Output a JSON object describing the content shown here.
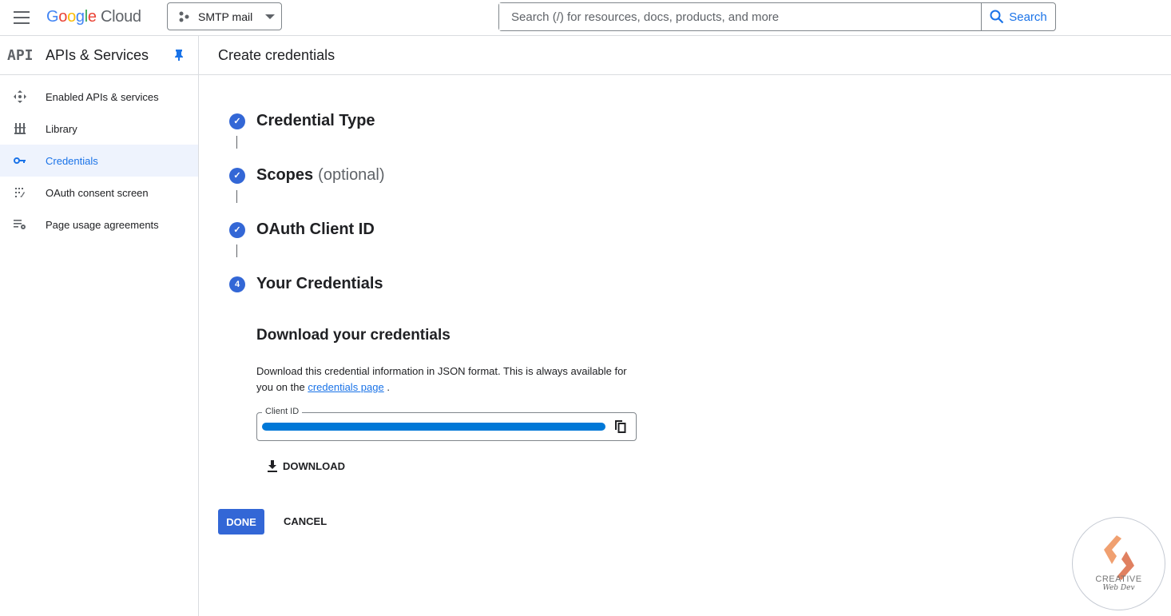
{
  "header": {
    "logo": {
      "google": "Google",
      "cloud": "Cloud"
    },
    "project": "SMTP mail",
    "search_placeholder": "Search (/) for resources, docs, products, and more",
    "search_button": "Search"
  },
  "sidebar": {
    "badge": "API",
    "title": "APIs & Services",
    "items": [
      {
        "label": "Enabled APIs & services",
        "icon": "enabled-apis-icon"
      },
      {
        "label": "Library",
        "icon": "library-icon"
      },
      {
        "label": "Credentials",
        "icon": "key-icon",
        "active": true
      },
      {
        "label": "OAuth consent screen",
        "icon": "oauth-consent-icon"
      },
      {
        "label": "Page usage agreements",
        "icon": "settings-list-icon"
      }
    ]
  },
  "main": {
    "title": "Create credentials",
    "steps": [
      {
        "label": "Credential Type",
        "done": true
      },
      {
        "label": "Scopes",
        "optional": "(optional)",
        "done": true
      },
      {
        "label": "OAuth Client ID",
        "done": true
      },
      {
        "label": "Your Credentials",
        "number": "4"
      }
    ],
    "download_heading": "Download your credentials",
    "desc_text": "Download this credential information in JSON format. This is always available for you on the ",
    "desc_link": "credentials page",
    "desc_end": " .",
    "client_id_label": "Client ID",
    "download_label": "DOWNLOAD",
    "done_label": "DONE",
    "cancel_label": "CANCEL"
  },
  "watermark": {
    "line1": "CREATIVE",
    "line2": "Web Dev"
  },
  "colors": {
    "accent": "#1a73e8",
    "primary_button": "#3367d6",
    "redaction": "#0078d7"
  }
}
